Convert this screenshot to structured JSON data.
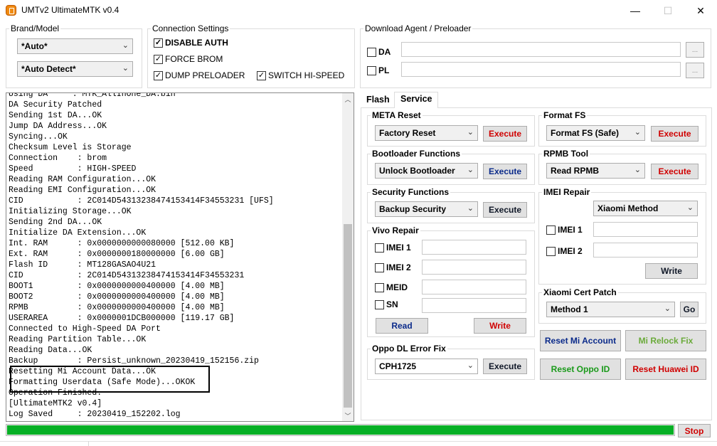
{
  "window": {
    "title": "UMTv2 UltimateMTK v0.4",
    "min_icon": "—",
    "max_icon": "☐",
    "close_icon": "✕"
  },
  "brand_model": {
    "title": "Brand/Model",
    "brand_value": "*Auto*",
    "model_value": "*Auto Detect*"
  },
  "connection": {
    "title": "Connection Settings",
    "disable_auth": {
      "label": "DISABLE AUTH",
      "checked": true
    },
    "force_brom": {
      "label": "FORCE BROM",
      "checked": true
    },
    "dump_preloader": {
      "label": "DUMP PRELOADER",
      "checked": true
    },
    "switch_hispeed": {
      "label": "SWITCH HI-SPEED",
      "checked": true
    }
  },
  "download_agent": {
    "title": "Download Agent / Preloader",
    "da_label": "DA",
    "pl_label": "PL",
    "browse_label": "..."
  },
  "log": {
    "lines": [
      "Using DA     : MTK_AllInOne_DA.bin",
      "DA Security Patched",
      "Sending 1st DA...OK",
      "Jump DA Address...OK",
      "Syncing...OK",
      "Checksum Level is Storage",
      "Connection    : brom",
      "Speed         : HIGH-SPEED",
      "Reading RAM Configuration...OK",
      "Reading EMI Configuration...OK",
      "CID           : 2C014D54313238474153414F34553231 [UFS]",
      "Initializing Storage...OK",
      "Sending 2nd DA...OK",
      "Initialize DA Extension...OK",
      "Int. RAM      : 0x0000000000080000 [512.00 KB]",
      "Ext. RAM      : 0x0000000180000000 [6.00 GB]",
      "Flash ID      : MT128GASAO4U21",
      "CID           : 2C014D54313238474153414F34553231",
      "BOOT1         : 0x0000000000400000 [4.00 MB]",
      "BOOT2         : 0x0000000000400000 [4.00 MB]",
      "RPMB          : 0x0000000000400000 [4.00 MB]",
      "USERAREA      : 0x0000001DCB000000 [119.17 GB]",
      "Connected to High-Speed DA Port",
      "Reading Partition Table...OK",
      "Reading Data...OK",
      "Backup        : Persist_unknown_20230419_152156.zip",
      "Resetting Mi Account Data...OK",
      "Formatting Userdata (Safe Mode)...OKOK",
      "Operation Finished.",
      "[UltimateMTK2 v0.4]",
      "Log Saved     : 20230419_152202.log"
    ]
  },
  "tabs": [
    {
      "label": "Flash",
      "active": false
    },
    {
      "label": "Service",
      "active": true
    }
  ],
  "meta_reset": {
    "title": "META Reset",
    "option": "Factory Reset",
    "button": "Execute"
  },
  "format_fs": {
    "title": "Format FS",
    "option": "Format FS (Safe)",
    "button": "Execute"
  },
  "bootloader": {
    "title": "Bootloader Functions",
    "option": "Unlock Bootloader",
    "button": "Execute"
  },
  "rpmb": {
    "title": "RPMB Tool",
    "option": "Read RPMB",
    "button": "Execute"
  },
  "security": {
    "title": "Security Functions",
    "option": "Backup Security",
    "button": "Execute"
  },
  "imei_repair": {
    "title": "IMEI Repair",
    "method": "Xiaomi Method",
    "imei1_label": "IMEI 1",
    "imei2_label": "IMEI 2",
    "write_button": "Write"
  },
  "vivo_repair": {
    "title": "Vivo Repair",
    "imei1_label": "IMEI 1",
    "imei2_label": "IMEI 2",
    "meid_label": "MEID",
    "sn_label": "SN",
    "read_button": "Read",
    "write_button": "Write"
  },
  "xiaomi_cert": {
    "title": "Xiaomi Cert Patch",
    "method": "Method 1",
    "go_button": "Go"
  },
  "oppo_dl": {
    "title": "Oppo DL Error Fix",
    "model": "CPH1725",
    "button": "Execute"
  },
  "actions": {
    "reset_mi_account": "Reset Mi Account",
    "mi_relock_fix": "Mi Relock Fix",
    "reset_oppo_id": "Reset Oppo ID",
    "reset_huawei_id": "Reset Huawei ID"
  },
  "progress": {
    "percent": 100
  },
  "stop_button": "Stop",
  "colors": {
    "progress": "#06b025",
    "execute_red": "#d00000",
    "execute_blue": "#0a2a8a",
    "green": "#1a9a1a"
  }
}
